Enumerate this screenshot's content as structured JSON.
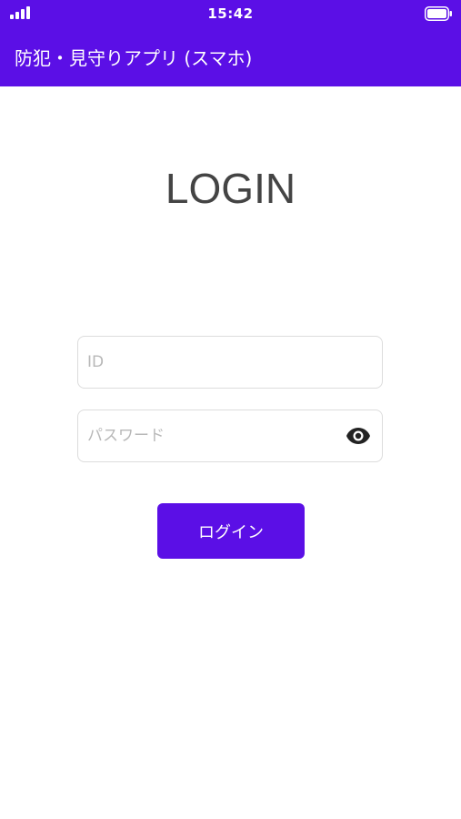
{
  "status_bar": {
    "time": "15:42",
    "icons": [
      "signal-icon",
      "battery-icon"
    ]
  },
  "app_bar": {
    "title": "防犯・見守りアプリ (スマホ)"
  },
  "login": {
    "heading": "LOGIN",
    "id_field": {
      "value": "",
      "placeholder": "ID"
    },
    "password_field": {
      "value": "",
      "placeholder": "パスワード",
      "toggle_icon": "eye-icon"
    },
    "submit_label": "ログイン"
  },
  "colors": {
    "accent": "#5b0fe6",
    "background": "#ffffff",
    "heading_text": "#444444",
    "placeholder_text": "#b8b8b8",
    "field_border": "#dcdcdc"
  }
}
